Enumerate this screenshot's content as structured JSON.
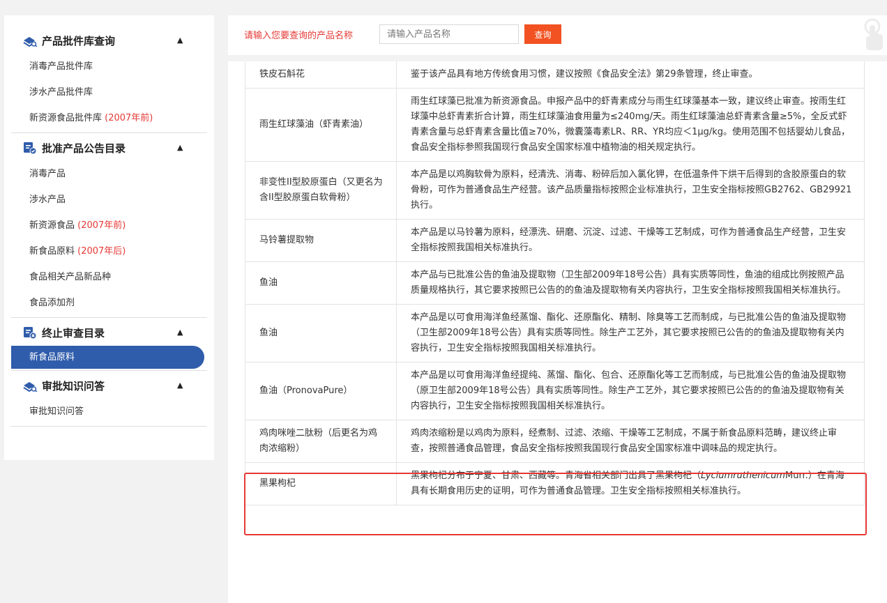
{
  "sidebar": {
    "groups": [
      {
        "title": "产品批件库查询",
        "icon": "database-search-icon",
        "items": [
          {
            "label": "消毒产品批件库",
            "suffix": ""
          },
          {
            "label": "涉水产品批件库",
            "suffix": ""
          },
          {
            "label": "新资源食品批件库",
            "suffix": "(2007年前)"
          }
        ]
      },
      {
        "title": "批准产品公告目录",
        "icon": "approved-list-icon",
        "items": [
          {
            "label": "消毒产品",
            "suffix": ""
          },
          {
            "label": "涉水产品",
            "suffix": ""
          },
          {
            "label": "新资源食品",
            "suffix": "(2007年前)"
          },
          {
            "label": "新食品原料",
            "suffix": "(2007年后)"
          },
          {
            "label": "食品相关产品新品种",
            "suffix": ""
          },
          {
            "label": "食品添加剂",
            "suffix": ""
          }
        ]
      },
      {
        "title": "终止审查目录",
        "icon": "terminated-list-icon",
        "items": [
          {
            "label": "新食品原料",
            "suffix": "",
            "active": true
          }
        ]
      },
      {
        "title": "审批知识问答",
        "icon": "knowledge-qa-icon",
        "items": [
          {
            "label": "审批知识问答",
            "suffix": ""
          }
        ]
      }
    ]
  },
  "search": {
    "label": "请输入您要查询的产品名称",
    "placeholder": "请输入产品名称",
    "value": "",
    "button": "查询"
  },
  "table": {
    "rows": [
      {
        "name": "铁皮石斛花",
        "desc": "鉴于该产品具有地方传统食用习惯，建议按照《食品安全法》第29条管理，终止审查。"
      },
      {
        "name": "雨生红球藻油（虾青素油）",
        "desc": "雨生红球藻已批准为新资源食品。申报产品中的虾青素成分与雨生红球藻基本一致，建议终止审查。按雨生红球藻中总虾青素折合计算，雨生红球藻油食用量为≤240mg/天。雨生红球藻油总虾青素含量≥5%，全反式虾青素含量与总虾青素含量比值≥70%，微囊藻毒素LR、RR、YR均应＜1μg/kg。使用范围不包括婴幼儿食品，食品安全指标参照我国现行食品安全国家标准中植物油的相关规定执行。"
      },
      {
        "name": "非变性II型胶原蛋白（又更名为含II型胶原蛋白软骨粉）",
        "desc": "本产品是以鸡胸软骨为原料，经清洗、消毒、粉碎后加入氯化钾，在低温条件下烘干后得到的含胶原蛋白的软骨粉，可作为普通食品生产经营。该产品质量指标按照企业标准执行，卫生安全指标按照GB2762、GB29921执行。"
      },
      {
        "name": "马铃薯提取物",
        "desc": "本产品是以马铃薯为原料，经漂洗、研磨、沉淀、过滤、干燥等工艺制成，可作为普通食品生产经营，卫生安全指标按照我国相关标准执行。"
      },
      {
        "name": "鱼油",
        "desc": "本产品与已批准公告的鱼油及提取物（卫生部2009年18号公告）具有实质等同性，鱼油的组成比例按照产品质量规格执行，其它要求按照已公告的的鱼油及提取物有关内容执行，卫生安全指标按照我国相关标准执行。"
      },
      {
        "name": "鱼油",
        "desc": "本产品是以可食用海洋鱼经蒸馏、酯化、还原酯化、精制、除臭等工艺而制成，与已批准公告的鱼油及提取物（卫生部2009年18号公告）具有实质等同性。除生产工艺外，其它要求按照已公告的的鱼油及提取物有关内容执行，卫生安全指标按照我国相关标准执行。"
      },
      {
        "name": "鱼油（PronovaPure）",
        "desc": "本产品是以可食用海洋鱼经提纯、蒸馏、酯化、包合、还原酯化等工艺而制成，与已批准公告的鱼油及提取物（原卫生部2009年18号公告）具有实质等同性。除生产工艺外，其它要求按照已公告的的鱼油及提取物有关内容执行，卫生安全指标按照我国相关标准执行。"
      },
      {
        "name": "鸡肉咪唑二肽粉（后更名为鸡肉浓缩粉）",
        "desc": "鸡肉浓缩粉是以鸡肉为原料，经煮制、过滤、浓缩、干燥等工艺制成，不属于新食品原料范畴，建议终止审查，按照普通食品管理，食品安全指标按照我国现行食品安全国家标准中调味品的规定执行。"
      },
      {
        "name": "黑果枸杞",
        "desc_pre": "黑果枸杞分布于宁夏、甘肃、西藏等。青海省相关部门出具了黑果枸杞（",
        "desc_italic": "Lyciumruthenicum",
        "desc_post": "Murr.）在青海具有长期食用历史的证明，可作为普通食品管理。卫生安全指标按照相关标准执行。"
      }
    ]
  },
  "colors": {
    "accent": "#2f5cab",
    "search_button": "#f25222",
    "label_red": "#e53935",
    "highlight": "#e53935"
  }
}
